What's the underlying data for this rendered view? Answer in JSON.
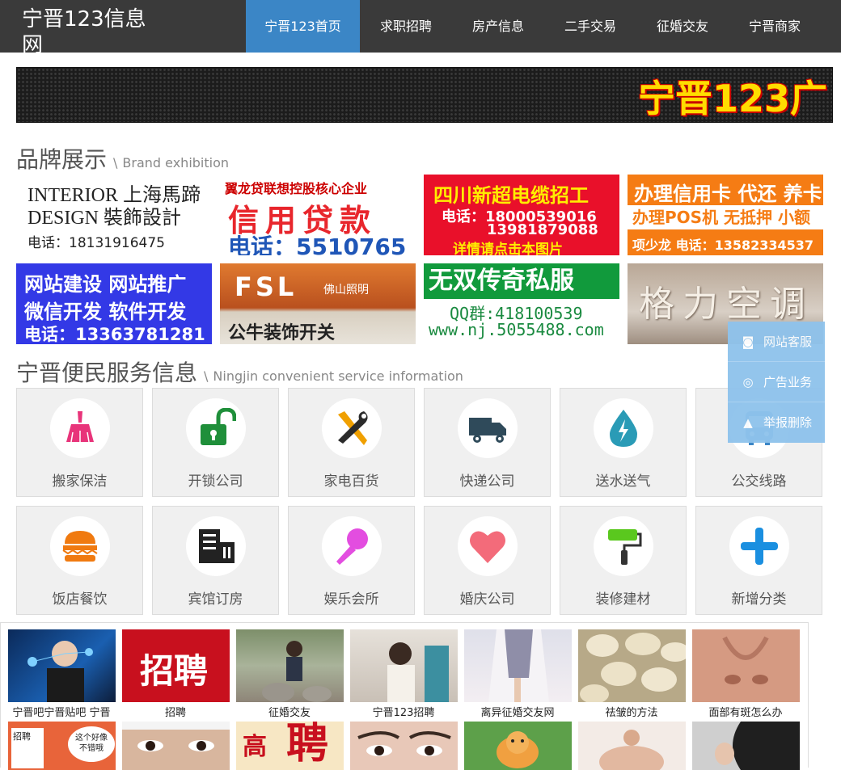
{
  "header": {
    "logo_title": "宁晋123信息网",
    "logo_url": "www.ningjin123.com.cn",
    "nav": [
      "宁晋123首页",
      "求职招聘",
      "房产信息",
      "二手交易",
      "征婚交友",
      "宁晋商家"
    ],
    "active_nav": "宁晋123首页"
  },
  "banner": {
    "text": "宁晋123广"
  },
  "brand_section": {
    "title": "品牌展示",
    "sep": "\\",
    "subtitle": "Brand exhibition",
    "ads": {
      "interior": {
        "line1": "INTERIOR 上海馬蹄",
        "line2": "DESIGN  裝飾設計",
        "phone": "电话：18131916475"
      },
      "xinyong": {
        "top": "翼龙贷联想控股核心企业",
        "main": "信用贷款",
        "phone": "电话：5510765"
      },
      "sichuan": {
        "title": "四川新超电缆招工",
        "phone1": "电话：18000539016",
        "phone2": "13981879088",
        "note": "详情请点击本图片"
      },
      "card": {
        "title": "办理信用卡 代还 养卡",
        "sub": "办理POS机 无抵押 小额贷款",
        "contact": "项少龙  电话：13582334537"
      },
      "web": {
        "line1": "网站建设 网站推广",
        "line2": "微信开发 软件开发",
        "line3": "电话：13363781281"
      },
      "fsl": {
        "big": "FSL",
        "small": "佛山照明",
        "sub": "公牛装饰开关"
      },
      "wushuang": {
        "title": "无双传奇私服",
        "qq": "QQ群:418100539",
        "url": "www.nj.5055488.com"
      },
      "geli": {
        "text": "格力空调"
      }
    }
  },
  "service_section": {
    "title": "宁晋便民服务信息",
    "sep": "\\",
    "subtitle": "Ningjin convenient service information",
    "items": [
      "搬家保洁",
      "开锁公司",
      "家电百货",
      "快递公司",
      "送水送气",
      "公交线路",
      "饭店餐饮",
      "宾馆订房",
      "娱乐会所",
      "婚庆公司",
      "装修建材",
      "新增分类"
    ],
    "icon_names": [
      "broom-icon",
      "unlock-icon",
      "tools-icon",
      "truck-icon",
      "water-drop-icon",
      "bus-icon",
      "burger-icon",
      "hotel-icon",
      "microphone-icon",
      "heart-icon",
      "paint-roller-icon",
      "plus-icon"
    ],
    "icon_colors": [
      "#e8347a",
      "#1f8f3a",
      "#f0a000",
      "#2f4a5a",
      "#2a9bb6",
      "#3b86c6",
      "#f07a10",
      "#222222",
      "#e34de0",
      "#f36b7a",
      "#5ac81e",
      "#1a8fe0"
    ]
  },
  "float_menu": [
    "网站客服",
    "广告业务",
    "举报删除"
  ],
  "news_row1": [
    "宁晋吧宁晋贴吧 宁晋",
    "招聘",
    "征婚交友",
    "宁晋123招聘",
    "离异征婚交友网",
    "祛皱的方法",
    "面部有斑怎么办"
  ],
  "news_row2_text": [
    "招聘",
    "这个好像",
    "不错哦",
    "高",
    "聘"
  ],
  "colors": {
    "header_bg": "#3a3a3a",
    "nav_active": "#3b86c6",
    "float_bg": "#8fc3ec"
  }
}
